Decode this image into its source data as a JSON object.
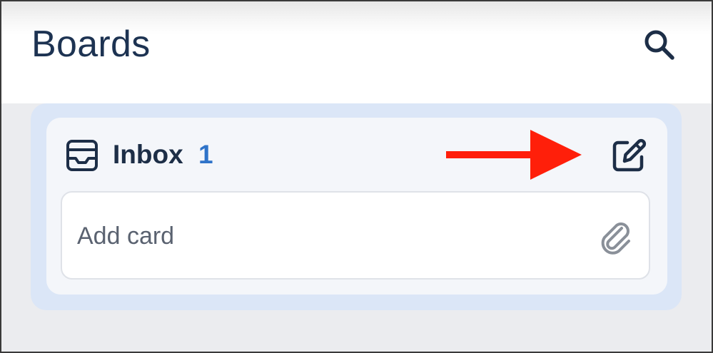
{
  "header": {
    "title": "Boards",
    "search_icon": "search-icon"
  },
  "list": {
    "icon": "inbox-icon",
    "title": "Inbox",
    "count": "1",
    "edit_icon": "edit-icon",
    "add_card": {
      "placeholder": "Add card",
      "attach_icon": "paperclip-icon"
    }
  },
  "annotation": {
    "icon": "arrow-right-icon",
    "color": "#ff1f0a"
  },
  "colors": {
    "title_text": "#1d3352",
    "count_accent": "#2f73c9",
    "list_bg": "#f4f6fa",
    "list_border": "#dbe6f7",
    "page_bg": "#ebecef"
  }
}
